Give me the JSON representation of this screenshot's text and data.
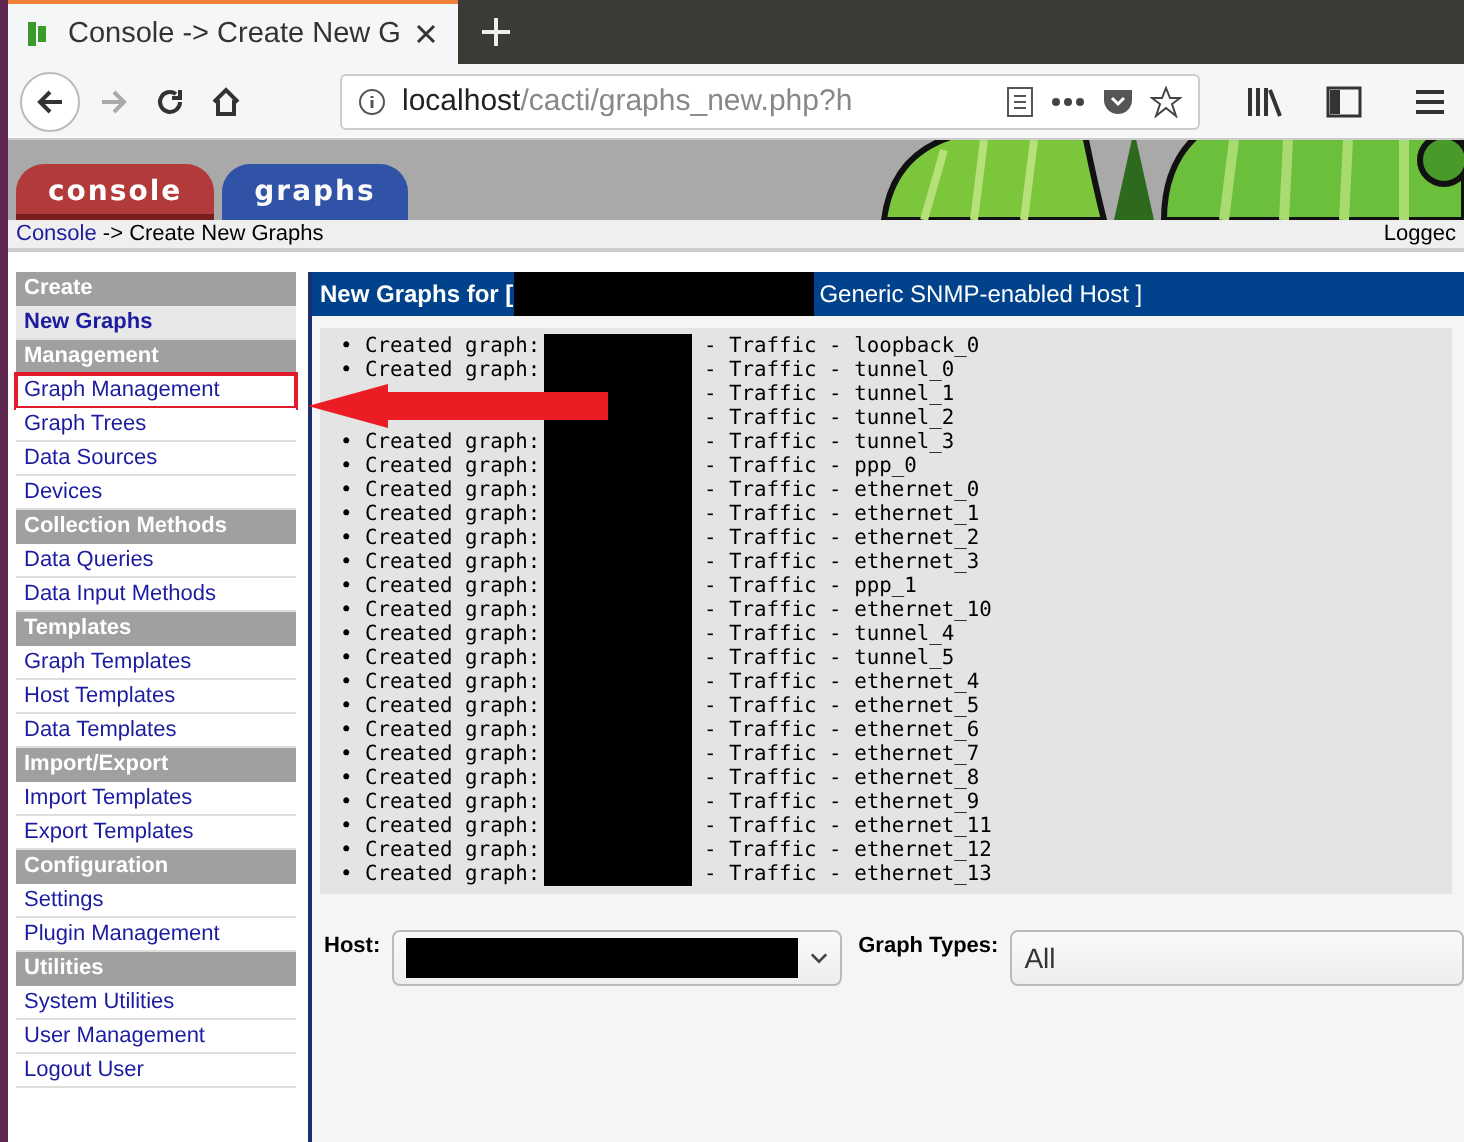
{
  "browser": {
    "tab_title": "Console -> Create New G",
    "url_host": "localhost",
    "url_path": "/cacti/graphs_new.php?h"
  },
  "banner": {
    "tabs": [
      {
        "label": "console",
        "selected": true,
        "color": "#b23a3a"
      },
      {
        "label": "graphs",
        "selected": false,
        "color": "#2a4fa8"
      }
    ]
  },
  "breadcrumb": {
    "link": "Console",
    "rest": "-> Create New Graphs",
    "user": "Loggec"
  },
  "sidebar": [
    {
      "kind": "header",
      "label": "Create"
    },
    {
      "kind": "item",
      "label": "New Graphs",
      "selected": true,
      "highlighted": false
    },
    {
      "kind": "header",
      "label": "Management"
    },
    {
      "kind": "item",
      "label": "Graph Management",
      "selected": false,
      "highlighted": true
    },
    {
      "kind": "item",
      "label": "Graph Trees",
      "selected": false,
      "highlighted": false
    },
    {
      "kind": "item",
      "label": "Data Sources",
      "selected": false,
      "highlighted": false
    },
    {
      "kind": "item",
      "label": "Devices",
      "selected": false,
      "highlighted": false
    },
    {
      "kind": "header",
      "label": "Collection Methods"
    },
    {
      "kind": "item",
      "label": "Data Queries",
      "selected": false,
      "highlighted": false
    },
    {
      "kind": "item",
      "label": "Data Input Methods",
      "selected": false,
      "highlighted": false
    },
    {
      "kind": "header",
      "label": "Templates"
    },
    {
      "kind": "item",
      "label": "Graph Templates",
      "selected": false,
      "highlighted": false
    },
    {
      "kind": "item",
      "label": "Host Templates",
      "selected": false,
      "highlighted": false
    },
    {
      "kind": "item",
      "label": "Data Templates",
      "selected": false,
      "highlighted": false
    },
    {
      "kind": "header",
      "label": "Import/Export"
    },
    {
      "kind": "item",
      "label": "Import Templates",
      "selected": false,
      "highlighted": false
    },
    {
      "kind": "item",
      "label": "Export Templates",
      "selected": false,
      "highlighted": false
    },
    {
      "kind": "header",
      "label": "Configuration"
    },
    {
      "kind": "item",
      "label": "Settings",
      "selected": false,
      "highlighted": false
    },
    {
      "kind": "item",
      "label": "Plugin Management",
      "selected": false,
      "highlighted": false
    },
    {
      "kind": "header",
      "label": "Utilities"
    },
    {
      "kind": "item",
      "label": "System Utilities",
      "selected": false,
      "highlighted": false
    },
    {
      "kind": "item",
      "label": "User Management",
      "selected": false,
      "highlighted": false
    },
    {
      "kind": "item",
      "label": "Logout User",
      "selected": false,
      "highlighted": false
    }
  ],
  "panel": {
    "title_start": "New Graphs for [",
    "title_end": "Generic SNMP-enabled Host ]",
    "lines": [
      {
        "prefix": "• Created graph:",
        "suffix": "- Traffic - loopback_0"
      },
      {
        "prefix": "• Created graph:",
        "suffix": "- Traffic - tunnel_0"
      },
      {
        "suffix": "- Traffic - tunnel_1"
      },
      {
        "suffix": "- Traffic - tunnel_2"
      },
      {
        "prefix": "• Created graph:",
        "suffix": "- Traffic - tunnel_3"
      },
      {
        "prefix": "• Created graph:",
        "suffix": "- Traffic - ppp_0"
      },
      {
        "prefix": "• Created graph:",
        "suffix": "- Traffic - ethernet_0"
      },
      {
        "prefix": "• Created graph:",
        "suffix": "- Traffic - ethernet_1"
      },
      {
        "prefix": "• Created graph:",
        "suffix": "- Traffic - ethernet_2"
      },
      {
        "prefix": "• Created graph:",
        "suffix": "- Traffic - ethernet_3"
      },
      {
        "prefix": "• Created graph:",
        "suffix": "- Traffic - ppp_1"
      },
      {
        "prefix": "• Created graph:",
        "suffix": "- Traffic - ethernet_10"
      },
      {
        "prefix": "• Created graph:",
        "suffix": "- Traffic - tunnel_4"
      },
      {
        "prefix": "• Created graph:",
        "suffix": "- Traffic - tunnel_5"
      },
      {
        "prefix": "• Created graph:",
        "suffix": "- Traffic - ethernet_4"
      },
      {
        "prefix": "• Created graph:",
        "suffix": "- Traffic - ethernet_5"
      },
      {
        "prefix": "• Created graph:",
        "suffix": "- Traffic - ethernet_6"
      },
      {
        "prefix": "• Created graph:",
        "suffix": "- Traffic - ethernet_7"
      },
      {
        "prefix": "• Created graph:",
        "suffix": "- Traffic - ethernet_8"
      },
      {
        "prefix": "• Created graph:",
        "suffix": "- Traffic - ethernet_9"
      },
      {
        "prefix": "• Created graph:",
        "suffix": "- Traffic - ethernet_11"
      },
      {
        "prefix": "• Created graph:",
        "suffix": "- Traffic - ethernet_12"
      },
      {
        "prefix": "• Created graph:",
        "suffix": "- Traffic - ethernet_13"
      }
    ]
  },
  "filters": {
    "host_label": "Host:",
    "types_label": "Graph Types:",
    "types_value": "All"
  }
}
